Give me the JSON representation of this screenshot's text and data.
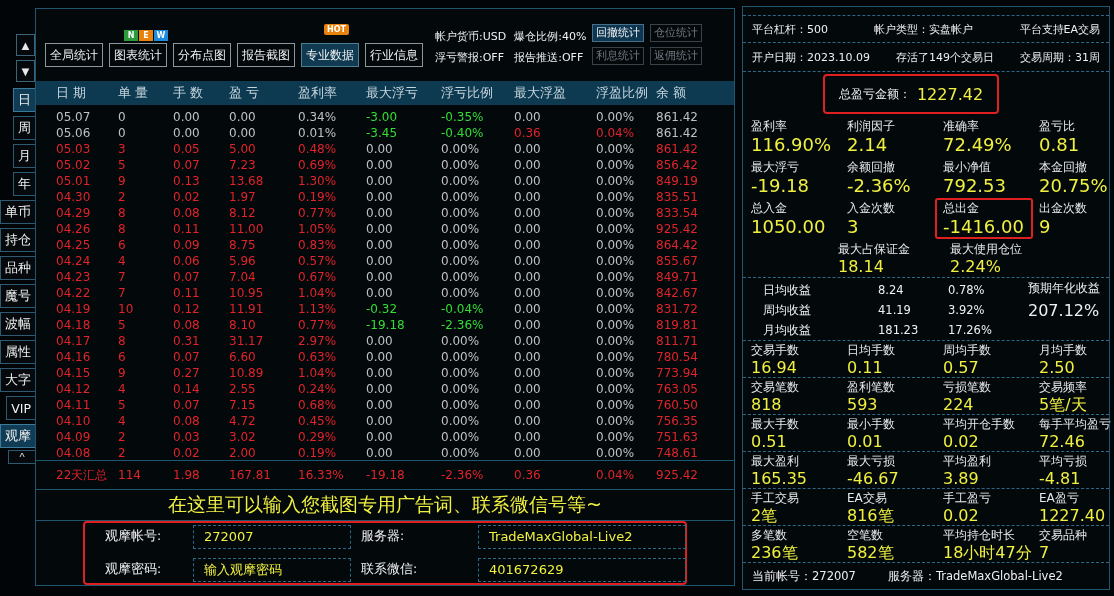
{
  "nav_arrows": [
    "▲",
    "▼"
  ],
  "side_tabs": [
    {
      "label": "日",
      "selected": true
    },
    {
      "label": "周",
      "selected": false
    },
    {
      "label": "月",
      "selected": false
    },
    {
      "label": "年",
      "selected": false
    },
    {
      "label": "单币",
      "selected": false
    },
    {
      "label": "持仓",
      "selected": false
    },
    {
      "label": "品种",
      "selected": false
    },
    {
      "label": "魔号",
      "selected": false
    },
    {
      "label": "波幅",
      "selected": false
    },
    {
      "label": "属性",
      "selected": false
    },
    {
      "label": "大字",
      "selected": false
    },
    {
      "label": "VIP",
      "selected": false
    },
    {
      "label": "观摩",
      "selected": true
    }
  ],
  "side_collapse": "^",
  "toolbar": {
    "buttons": [
      {
        "label": "全局统计",
        "selected": false
      },
      {
        "label": "图表统计",
        "selected": false,
        "badge": {
          "kind": "new",
          "letters": [
            {
              "text": "N",
              "color": "#2a9a3a"
            },
            {
              "text": "E",
              "color": "#e8820c"
            },
            {
              "text": "W",
              "color": "#1e8ae0"
            }
          ]
        }
      },
      {
        "label": "分布点图",
        "selected": false
      },
      {
        "label": "报告截图",
        "selected": false
      },
      {
        "label": "专业数据",
        "selected": true,
        "badge": {
          "kind": "hot",
          "letters": [
            {
              "text": "HOT",
              "color": "#e8820c"
            }
          ]
        }
      },
      {
        "label": "行业信息",
        "selected": false
      }
    ],
    "info": [
      "帐户货币:USD",
      "爆仓比例:40%",
      "浮亏警报:OFF",
      "报告推送:OFF"
    ],
    "side_buttons": [
      {
        "label": "回撤统计",
        "disabled": false
      },
      {
        "label": "仓位统计",
        "disabled": true
      },
      {
        "label": "利息统计",
        "disabled": true
      },
      {
        "label": "返佣统计",
        "disabled": true
      }
    ]
  },
  "table": {
    "columns": [
      "日 期",
      "单 量",
      "手 数",
      "盈 亏",
      "盈利率",
      "最大浮亏",
      "浮亏比例",
      "最大浮盈",
      "浮盈比例",
      "余 额"
    ],
    "rows": [
      {
        "cells": [
          {
            "text": "05.07",
            "color": "#c0c0c0"
          },
          {
            "text": "0",
            "color": "#c0c0c0"
          },
          {
            "text": "0.00",
            "color": "#c0c0c0"
          },
          {
            "text": "0.00",
            "color": "#c0c0c0"
          },
          {
            "text": "0.34%",
            "color": "#c0c0c0"
          },
          {
            "text": "-3.00",
            "color": "#33dd33"
          },
          {
            "text": "-0.35%",
            "color": "#33dd33"
          },
          {
            "text": "0.00",
            "color": "#c0c0c0"
          },
          {
            "text": "0.00%",
            "color": "#c0c0c0"
          },
          {
            "text": "861.42",
            "color": "#c0c0c0"
          }
        ]
      },
      {
        "cells": [
          {
            "text": "05.06",
            "color": "#c0c0c0"
          },
          {
            "text": "0",
            "color": "#c0c0c0"
          },
          {
            "text": "0.00",
            "color": "#c0c0c0"
          },
          {
            "text": "0.00",
            "color": "#c0c0c0"
          },
          {
            "text": "0.01%",
            "color": "#c0c0c0"
          },
          {
            "text": "-3.45",
            "color": "#33dd33"
          },
          {
            "text": "-0.40%",
            "color": "#33dd33"
          },
          {
            "text": "0.36",
            "color": "#e0242a"
          },
          {
            "text": "0.04%",
            "color": "#e0242a"
          },
          {
            "text": "861.42",
            "color": "#c0c0c0"
          }
        ]
      },
      {
        "cells": [
          {
            "text": "05.03",
            "color": "#e0242a"
          },
          {
            "text": "3",
            "color": "#e0242a"
          },
          {
            "text": "0.05",
            "color": "#e0242a"
          },
          {
            "text": "5.00",
            "color": "#e0242a"
          },
          {
            "text": "0.48%",
            "color": "#e0242a"
          },
          {
            "text": "0.00",
            "color": "#c0c0c0"
          },
          {
            "text": "0.00%",
            "color": "#c0c0c0"
          },
          {
            "text": "0.00",
            "color": "#c0c0c0"
          },
          {
            "text": "0.00%",
            "color": "#c0c0c0"
          },
          {
            "text": "861.42",
            "color": "#e0242a"
          }
        ]
      },
      {
        "cells": [
          {
            "text": "05.02",
            "color": "#e0242a"
          },
          {
            "text": "5",
            "color": "#e0242a"
          },
          {
            "text": "0.07",
            "color": "#e0242a"
          },
          {
            "text": "7.23",
            "color": "#e0242a"
          },
          {
            "text": "0.69%",
            "color": "#e0242a"
          },
          {
            "text": "0.00",
            "color": "#c0c0c0"
          },
          {
            "text": "0.00%",
            "color": "#c0c0c0"
          },
          {
            "text": "0.00",
            "color": "#c0c0c0"
          },
          {
            "text": "0.00%",
            "color": "#c0c0c0"
          },
          {
            "text": "856.42",
            "color": "#e0242a"
          }
        ]
      },
      {
        "cells": [
          {
            "text": "05.01",
            "color": "#e0242a"
          },
          {
            "text": "9",
            "color": "#e0242a"
          },
          {
            "text": "0.13",
            "color": "#e0242a"
          },
          {
            "text": "13.68",
            "color": "#e0242a"
          },
          {
            "text": "1.30%",
            "color": "#e0242a"
          },
          {
            "text": "0.00",
            "color": "#c0c0c0"
          },
          {
            "text": "0.00%",
            "color": "#c0c0c0"
          },
          {
            "text": "0.00",
            "color": "#c0c0c0"
          },
          {
            "text": "0.00%",
            "color": "#c0c0c0"
          },
          {
            "text": "849.19",
            "color": "#e0242a"
          }
        ]
      },
      {
        "cells": [
          {
            "text": "04.30",
            "color": "#e0242a"
          },
          {
            "text": "2",
            "color": "#e0242a"
          },
          {
            "text": "0.02",
            "color": "#e0242a"
          },
          {
            "text": "1.97",
            "color": "#e0242a"
          },
          {
            "text": "0.19%",
            "color": "#e0242a"
          },
          {
            "text": "0.00",
            "color": "#c0c0c0"
          },
          {
            "text": "0.00%",
            "color": "#c0c0c0"
          },
          {
            "text": "0.00",
            "color": "#c0c0c0"
          },
          {
            "text": "0.00%",
            "color": "#c0c0c0"
          },
          {
            "text": "835.51",
            "color": "#e0242a"
          }
        ]
      },
      {
        "cells": [
          {
            "text": "04.29",
            "color": "#e0242a"
          },
          {
            "text": "8",
            "color": "#e0242a"
          },
          {
            "text": "0.08",
            "color": "#e0242a"
          },
          {
            "text": "8.12",
            "color": "#e0242a"
          },
          {
            "text": "0.77%",
            "color": "#e0242a"
          },
          {
            "text": "0.00",
            "color": "#c0c0c0"
          },
          {
            "text": "0.00%",
            "color": "#c0c0c0"
          },
          {
            "text": "0.00",
            "color": "#c0c0c0"
          },
          {
            "text": "0.00%",
            "color": "#c0c0c0"
          },
          {
            "text": "833.54",
            "color": "#e0242a"
          }
        ]
      },
      {
        "cells": [
          {
            "text": "04.26",
            "color": "#e0242a"
          },
          {
            "text": "8",
            "color": "#e0242a"
          },
          {
            "text": "0.11",
            "color": "#e0242a"
          },
          {
            "text": "11.00",
            "color": "#e0242a"
          },
          {
            "text": "1.05%",
            "color": "#e0242a"
          },
          {
            "text": "0.00",
            "color": "#c0c0c0"
          },
          {
            "text": "0.00%",
            "color": "#c0c0c0"
          },
          {
            "text": "0.00",
            "color": "#c0c0c0"
          },
          {
            "text": "0.00%",
            "color": "#c0c0c0"
          },
          {
            "text": "925.42",
            "color": "#e0242a"
          }
        ]
      },
      {
        "cells": [
          {
            "text": "04.25",
            "color": "#e0242a"
          },
          {
            "text": "6",
            "color": "#e0242a"
          },
          {
            "text": "0.09",
            "color": "#e0242a"
          },
          {
            "text": "8.75",
            "color": "#e0242a"
          },
          {
            "text": "0.83%",
            "color": "#e0242a"
          },
          {
            "text": "0.00",
            "color": "#c0c0c0"
          },
          {
            "text": "0.00%",
            "color": "#c0c0c0"
          },
          {
            "text": "0.00",
            "color": "#c0c0c0"
          },
          {
            "text": "0.00%",
            "color": "#c0c0c0"
          },
          {
            "text": "864.42",
            "color": "#e0242a"
          }
        ]
      },
      {
        "cells": [
          {
            "text": "04.24",
            "color": "#e0242a"
          },
          {
            "text": "4",
            "color": "#e0242a"
          },
          {
            "text": "0.06",
            "color": "#e0242a"
          },
          {
            "text": "5.96",
            "color": "#e0242a"
          },
          {
            "text": "0.57%",
            "color": "#e0242a"
          },
          {
            "text": "0.00",
            "color": "#c0c0c0"
          },
          {
            "text": "0.00%",
            "color": "#c0c0c0"
          },
          {
            "text": "0.00",
            "color": "#c0c0c0"
          },
          {
            "text": "0.00%",
            "color": "#c0c0c0"
          },
          {
            "text": "855.67",
            "color": "#e0242a"
          }
        ]
      },
      {
        "cells": [
          {
            "text": "04.23",
            "color": "#e0242a"
          },
          {
            "text": "7",
            "color": "#e0242a"
          },
          {
            "text": "0.07",
            "color": "#e0242a"
          },
          {
            "text": "7.04",
            "color": "#e0242a"
          },
          {
            "text": "0.67%",
            "color": "#e0242a"
          },
          {
            "text": "0.00",
            "color": "#c0c0c0"
          },
          {
            "text": "0.00%",
            "color": "#c0c0c0"
          },
          {
            "text": "0.00",
            "color": "#c0c0c0"
          },
          {
            "text": "0.00%",
            "color": "#c0c0c0"
          },
          {
            "text": "849.71",
            "color": "#e0242a"
          }
        ]
      },
      {
        "cells": [
          {
            "text": "04.22",
            "color": "#e0242a"
          },
          {
            "text": "7",
            "color": "#e0242a"
          },
          {
            "text": "0.11",
            "color": "#e0242a"
          },
          {
            "text": "10.95",
            "color": "#e0242a"
          },
          {
            "text": "1.04%",
            "color": "#e0242a"
          },
          {
            "text": "0.00",
            "color": "#c0c0c0"
          },
          {
            "text": "0.00%",
            "color": "#c0c0c0"
          },
          {
            "text": "0.00",
            "color": "#c0c0c0"
          },
          {
            "text": "0.00%",
            "color": "#c0c0c0"
          },
          {
            "text": "842.67",
            "color": "#e0242a"
          }
        ]
      },
      {
        "cells": [
          {
            "text": "04.19",
            "color": "#e0242a"
          },
          {
            "text": "10",
            "color": "#e0242a"
          },
          {
            "text": "0.12",
            "color": "#e0242a"
          },
          {
            "text": "11.91",
            "color": "#e0242a"
          },
          {
            "text": "1.13%",
            "color": "#e0242a"
          },
          {
            "text": "-0.32",
            "color": "#33dd33"
          },
          {
            "text": "-0.04%",
            "color": "#33dd33"
          },
          {
            "text": "0.00",
            "color": "#c0c0c0"
          },
          {
            "text": "0.00%",
            "color": "#c0c0c0"
          },
          {
            "text": "831.72",
            "color": "#e0242a"
          }
        ]
      },
      {
        "cells": [
          {
            "text": "04.18",
            "color": "#e0242a"
          },
          {
            "text": "5",
            "color": "#e0242a"
          },
          {
            "text": "0.08",
            "color": "#e0242a"
          },
          {
            "text": "8.10",
            "color": "#e0242a"
          },
          {
            "text": "0.77%",
            "color": "#e0242a"
          },
          {
            "text": "-19.18",
            "color": "#33dd33"
          },
          {
            "text": "-2.36%",
            "color": "#33dd33"
          },
          {
            "text": "0.00",
            "color": "#c0c0c0"
          },
          {
            "text": "0.00%",
            "color": "#c0c0c0"
          },
          {
            "text": "819.81",
            "color": "#e0242a"
          }
        ]
      },
      {
        "cells": [
          {
            "text": "04.17",
            "color": "#e0242a"
          },
          {
            "text": "8",
            "color": "#e0242a"
          },
          {
            "text": "0.31",
            "color": "#e0242a"
          },
          {
            "text": "31.17",
            "color": "#e0242a"
          },
          {
            "text": "2.97%",
            "color": "#e0242a"
          },
          {
            "text": "0.00",
            "color": "#c0c0c0"
          },
          {
            "text": "0.00%",
            "color": "#c0c0c0"
          },
          {
            "text": "0.00",
            "color": "#c0c0c0"
          },
          {
            "text": "0.00%",
            "color": "#c0c0c0"
          },
          {
            "text": "811.71",
            "color": "#e0242a"
          }
        ]
      },
      {
        "cells": [
          {
            "text": "04.16",
            "color": "#e0242a"
          },
          {
            "text": "6",
            "color": "#e0242a"
          },
          {
            "text": "0.07",
            "color": "#e0242a"
          },
          {
            "text": "6.60",
            "color": "#e0242a"
          },
          {
            "text": "0.63%",
            "color": "#e0242a"
          },
          {
            "text": "0.00",
            "color": "#c0c0c0"
          },
          {
            "text": "0.00%",
            "color": "#c0c0c0"
          },
          {
            "text": "0.00",
            "color": "#c0c0c0"
          },
          {
            "text": "0.00%",
            "color": "#c0c0c0"
          },
          {
            "text": "780.54",
            "color": "#e0242a"
          }
        ]
      },
      {
        "cells": [
          {
            "text": "04.15",
            "color": "#e0242a"
          },
          {
            "text": "9",
            "color": "#e0242a"
          },
          {
            "text": "0.27",
            "color": "#e0242a"
          },
          {
            "text": "10.89",
            "color": "#e0242a"
          },
          {
            "text": "1.04%",
            "color": "#e0242a"
          },
          {
            "text": "0.00",
            "color": "#c0c0c0"
          },
          {
            "text": "0.00%",
            "color": "#c0c0c0"
          },
          {
            "text": "0.00",
            "color": "#c0c0c0"
          },
          {
            "text": "0.00%",
            "color": "#c0c0c0"
          },
          {
            "text": "773.94",
            "color": "#e0242a"
          }
        ]
      },
      {
        "cells": [
          {
            "text": "04.12",
            "color": "#e0242a"
          },
          {
            "text": "4",
            "color": "#e0242a"
          },
          {
            "text": "0.14",
            "color": "#e0242a"
          },
          {
            "text": "2.55",
            "color": "#e0242a"
          },
          {
            "text": "0.24%",
            "color": "#e0242a"
          },
          {
            "text": "0.00",
            "color": "#c0c0c0"
          },
          {
            "text": "0.00%",
            "color": "#c0c0c0"
          },
          {
            "text": "0.00",
            "color": "#c0c0c0"
          },
          {
            "text": "0.00%",
            "color": "#c0c0c0"
          },
          {
            "text": "763.05",
            "color": "#e0242a"
          }
        ]
      },
      {
        "cells": [
          {
            "text": "04.11",
            "color": "#e0242a"
          },
          {
            "text": "5",
            "color": "#e0242a"
          },
          {
            "text": "0.07",
            "color": "#e0242a"
          },
          {
            "text": "7.15",
            "color": "#e0242a"
          },
          {
            "text": "0.68%",
            "color": "#e0242a"
          },
          {
            "text": "0.00",
            "color": "#c0c0c0"
          },
          {
            "text": "0.00%",
            "color": "#c0c0c0"
          },
          {
            "text": "0.00",
            "color": "#c0c0c0"
          },
          {
            "text": "0.00%",
            "color": "#c0c0c0"
          },
          {
            "text": "760.50",
            "color": "#e0242a"
          }
        ]
      },
      {
        "cells": [
          {
            "text": "04.10",
            "color": "#e0242a"
          },
          {
            "text": "4",
            "color": "#e0242a"
          },
          {
            "text": "0.08",
            "color": "#e0242a"
          },
          {
            "text": "4.72",
            "color": "#e0242a"
          },
          {
            "text": "0.45%",
            "color": "#e0242a"
          },
          {
            "text": "0.00",
            "color": "#c0c0c0"
          },
          {
            "text": "0.00%",
            "color": "#c0c0c0"
          },
          {
            "text": "0.00",
            "color": "#c0c0c0"
          },
          {
            "text": "0.00%",
            "color": "#c0c0c0"
          },
          {
            "text": "756.35",
            "color": "#e0242a"
          }
        ]
      },
      {
        "cells": [
          {
            "text": "04.09",
            "color": "#e0242a"
          },
          {
            "text": "2",
            "color": "#e0242a"
          },
          {
            "text": "0.03",
            "color": "#e0242a"
          },
          {
            "text": "3.02",
            "color": "#e0242a"
          },
          {
            "text": "0.29%",
            "color": "#e0242a"
          },
          {
            "text": "0.00",
            "color": "#c0c0c0"
          },
          {
            "text": "0.00%",
            "color": "#c0c0c0"
          },
          {
            "text": "0.00",
            "color": "#c0c0c0"
          },
          {
            "text": "0.00%",
            "color": "#c0c0c0"
          },
          {
            "text": "751.63",
            "color": "#e0242a"
          }
        ]
      },
      {
        "cells": [
          {
            "text": "04.08",
            "color": "#e0242a"
          },
          {
            "text": "2",
            "color": "#e0242a"
          },
          {
            "text": "0.02",
            "color": "#e0242a"
          },
          {
            "text": "2.00",
            "color": "#e0242a"
          },
          {
            "text": "0.19%",
            "color": "#e0242a"
          },
          {
            "text": "0.00",
            "color": "#c0c0c0"
          },
          {
            "text": "0.00%",
            "color": "#c0c0c0"
          },
          {
            "text": "0.00",
            "color": "#c0c0c0"
          },
          {
            "text": "0.00%",
            "color": "#c0c0c0"
          },
          {
            "text": "748.61",
            "color": "#e0242a"
          }
        ]
      }
    ],
    "summary": [
      "22天汇总",
      "114",
      "1.98",
      "167.81",
      "16.33%",
      "-19.18",
      "-2.36%",
      "0.36",
      "0.04%",
      "925.42"
    ]
  },
  "ad_text": "在这里可以输入您截图专用广告词、联系微信号等~",
  "account_form": {
    "fields": [
      {
        "label": "观摩帐号:",
        "value": "272007"
      },
      {
        "label": "服务器:",
        "value": "TradeMaxGlobal-Live2"
      },
      {
        "label": "观摩密码:",
        "placeholder": "输入观摩密码"
      },
      {
        "label": "联系微信:",
        "value": "401672629"
      }
    ]
  },
  "stats_panel": {
    "info_rows": [
      [
        "平台杠杆：500",
        "帐户类型：实盘帐户",
        "平台支持EA交易"
      ],
      [
        "开户日期：2023.10.09",
        "存活了149个交易日",
        "交易周期：31周"
      ]
    ],
    "total": {
      "label": "总盈亏金额：",
      "value": "1227.42"
    },
    "stats_top": [
      {
        "label": "盈利率",
        "value": "116.90%",
        "highlighted": false
      },
      {
        "label": "利润因子",
        "value": "2.14",
        "highlighted": false
      },
      {
        "label": "准确率",
        "value": "72.49%",
        "highlighted": false
      },
      {
        "label": "盈亏比",
        "value": "0.81",
        "highlighted": false
      },
      {
        "label": "最大浮亏",
        "value": "-19.18",
        "highlighted": false
      },
      {
        "label": "余额回撤",
        "value": "-2.36%",
        "highlighted": false
      },
      {
        "label": "最小净值",
        "value": "792.53",
        "highlighted": false
      },
      {
        "label": "本金回撤",
        "value": "20.75%",
        "highlighted": false
      },
      {
        "label": "总入金",
        "value": "1050.00",
        "highlighted": false
      },
      {
        "label": "入金次数",
        "value": "3",
        "highlighted": false
      },
      {
        "label": "总出金",
        "value": "-1416.00",
        "highlighted": true
      },
      {
        "label": "出金次数",
        "value": "9",
        "highlighted": false
      }
    ],
    "stats_pair": [
      {
        "label": "最大占保证金",
        "value": "18.14"
      },
      {
        "label": "最大使用仓位",
        "value": "2.24%"
      }
    ],
    "averages": {
      "rows": [
        [
          "日均收益",
          "8.24",
          "0.78%"
        ],
        [
          "周均收益",
          "41.19",
          "3.92%"
        ],
        [
          "月均收益",
          "181.23",
          "17.26%"
        ]
      ],
      "annual_label": "预期年化收益",
      "annual_value": "207.12%"
    },
    "stat_groups": [
      [
        {
          "label": "交易手数",
          "value": "16.94"
        },
        {
          "label": "日均手数",
          "value": "0.11"
        },
        {
          "label": "周均手数",
          "value": "0.57"
        },
        {
          "label": "月均手数",
          "value": "2.50"
        }
      ],
      [
        {
          "label": "交易笔数",
          "value": "818"
        },
        {
          "label": "盈利笔数",
          "value": "593"
        },
        {
          "label": "亏损笔数",
          "value": "224"
        },
        {
          "label": "交易频率",
          "value": "5笔/天"
        }
      ],
      [
        {
          "label": "最大手数",
          "value": "0.51"
        },
        {
          "label": "最小手数",
          "value": "0.01"
        },
        {
          "label": "平均开仓手数",
          "value": "0.02"
        },
        {
          "label": "每手平均盈亏",
          "value": "72.46"
        }
      ],
      [
        {
          "label": "最大盈利",
          "value": "165.35"
        },
        {
          "label": "最大亏损",
          "value": "-46.67"
        },
        {
          "label": "平均盈利",
          "value": "3.89"
        },
        {
          "label": "平均亏损",
          "value": "-4.81"
        }
      ],
      [
        {
          "label": "手工交易",
          "value": "2笔"
        },
        {
          "label": "EA交易",
          "value": "816笔"
        },
        {
          "label": "手工盈亏",
          "value": "0.02"
        },
        {
          "label": "EA盈亏",
          "value": "1227.40"
        }
      ],
      [
        {
          "label": "多笔数",
          "value": "236笔"
        },
        {
          "label": "空笔数",
          "value": "582笔"
        },
        {
          "label": "平均持仓时长",
          "value": "18小时47分"
        },
        {
          "label": "交易品种",
          "value": "7"
        }
      ]
    ],
    "footer": [
      "当前帐号：272007",
      "服务器：TradeMaxGlobal-Live2"
    ]
  }
}
